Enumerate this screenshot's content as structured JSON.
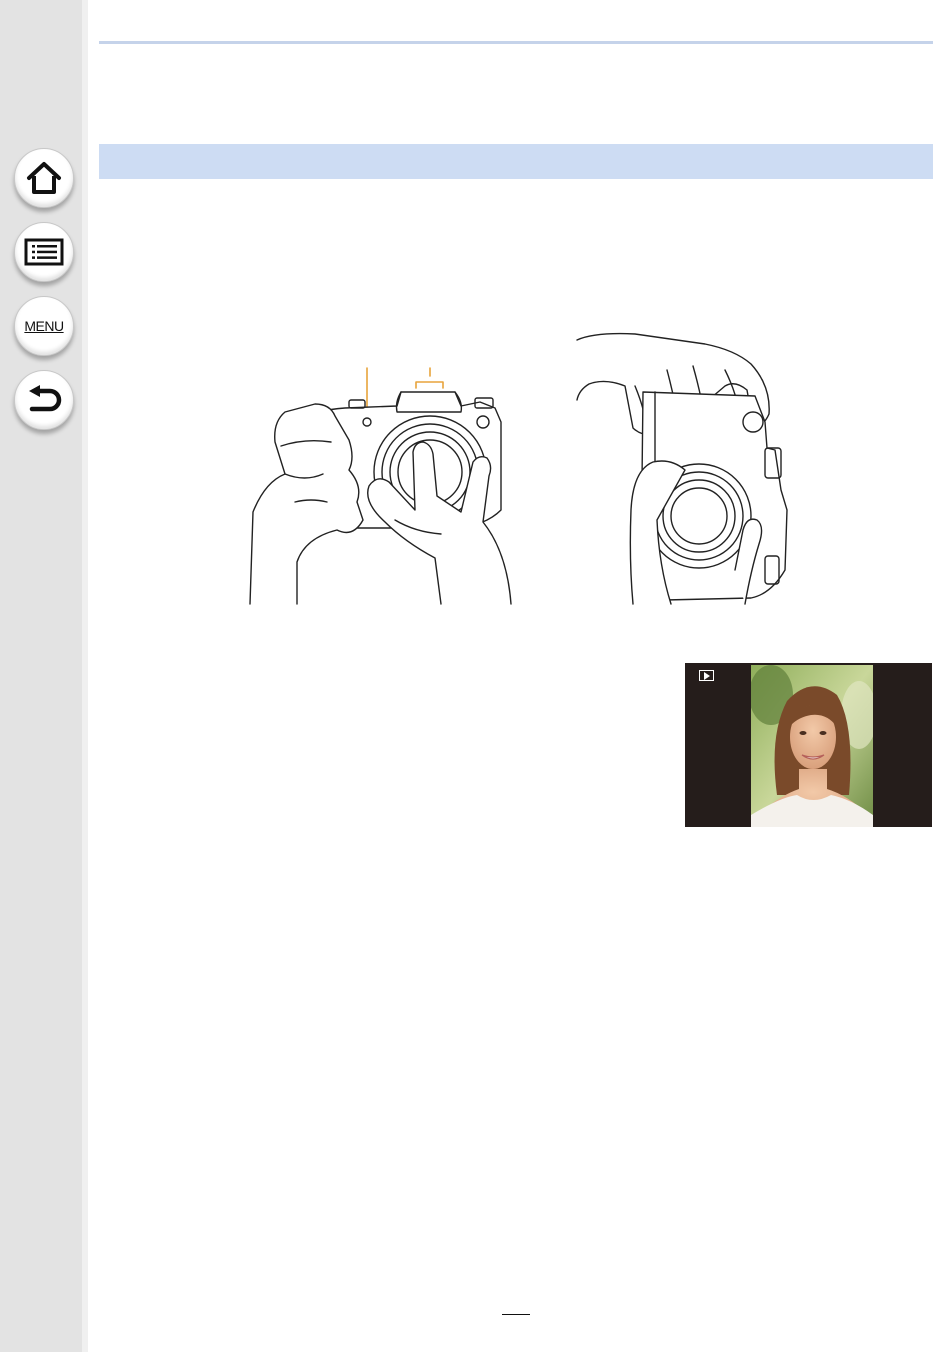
{
  "nav": {
    "home_icon": "home-icon",
    "contents_icon": "list-icon",
    "menu_label": "MENU",
    "back_icon": "return-arrow-icon"
  },
  "colors": {
    "sidebar": "#e3e3e3",
    "section_band": "#cddcf3",
    "callout": "#e8a33b"
  },
  "playback_screen": {
    "mode_icon": "playback-icon"
  },
  "page_number": ""
}
